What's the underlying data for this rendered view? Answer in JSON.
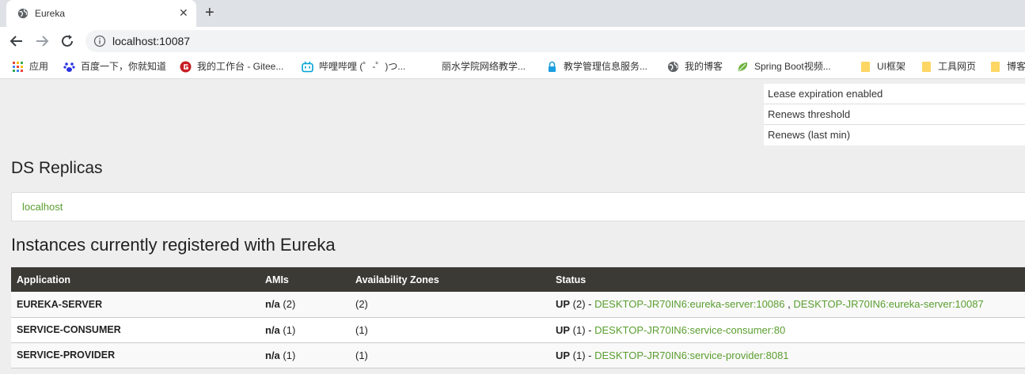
{
  "browser": {
    "tab_title": "Eureka",
    "url": "localhost:10087",
    "bookmarks": [
      {
        "label": "应用",
        "icon": "apps-grid-icon"
      },
      {
        "label": "百度一下，你就知道",
        "icon": "baidu-paw-icon"
      },
      {
        "label": "我的工作台 - Gitee...",
        "icon": "gitee-icon"
      },
      {
        "label": "哔哩哔哩 (゜-゜)つ...",
        "icon": "bilibili-icon"
      },
      {
        "label": "丽水学院网络教学...",
        "icon": "blank-page-icon"
      },
      {
        "label": "教学管理信息服务...",
        "icon": "lock-icon"
      },
      {
        "label": "我的博客",
        "icon": "globe-icon"
      },
      {
        "label": "Spring Boot视频...",
        "icon": "spring-leaf-icon"
      },
      {
        "label": "UI框架",
        "icon": "folder-icon"
      },
      {
        "label": "工具网页",
        "icon": "folder-icon"
      },
      {
        "label": "博客",
        "icon": "folder-icon"
      }
    ]
  },
  "lease": {
    "rows": [
      "Lease expiration enabled",
      "Renews threshold",
      "Renews (last min)"
    ]
  },
  "ds_replicas": {
    "heading": "DS Replicas",
    "replica": "localhost"
  },
  "instances": {
    "heading": "Instances currently registered with Eureka",
    "columns": [
      "Application",
      "AMIs",
      "Availability Zones",
      "Status"
    ],
    "rows": [
      {
        "application": "EUREKA-SERVER",
        "amis_bold": "n/a",
        "amis_count": " (2)",
        "zones": "(2)",
        "status_bold": "UP",
        "status_count": " (2) - ",
        "links": [
          "DESKTOP-JR70IN6:eureka-server:10086",
          "DESKTOP-JR70IN6:eureka-server:10087"
        ],
        "separator": " , "
      },
      {
        "application": "SERVICE-CONSUMER",
        "amis_bold": "n/a",
        "amis_count": " (1)",
        "zones": "(1)",
        "status_bold": "UP",
        "status_count": " (1) - ",
        "links": [
          "DESKTOP-JR70IN6:service-consumer:80"
        ]
      },
      {
        "application": "SERVICE-PROVIDER",
        "amis_bold": "n/a",
        "amis_count": " (1)",
        "zones": "(1)",
        "status_bold": "UP",
        "status_count": " (1) - ",
        "links": [
          "DESKTOP-JR70IN6:service-provider:8081"
        ]
      }
    ]
  },
  "colors": {
    "link_green": "#5a9e2f",
    "table_header": "#3c3a35",
    "page_bg": "#eeeeee"
  }
}
